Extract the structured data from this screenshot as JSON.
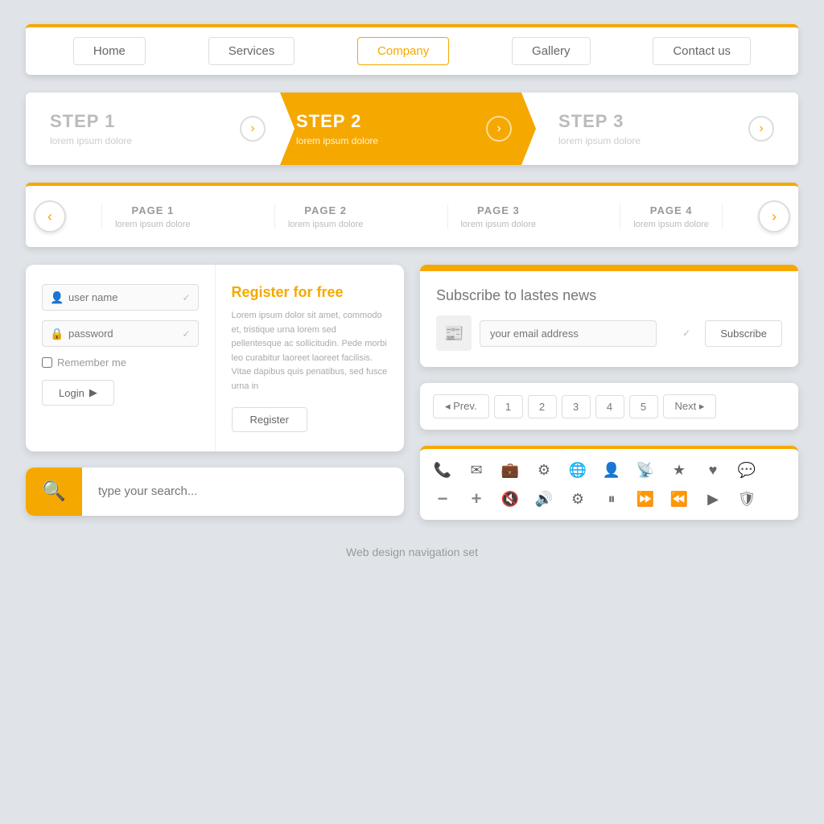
{
  "nav": {
    "items": [
      {
        "label": "Home",
        "active": false
      },
      {
        "label": "Services",
        "active": false
      },
      {
        "label": "Company",
        "active": true
      },
      {
        "label": "Gallery",
        "active": false
      },
      {
        "label": "Contact us",
        "active": false
      }
    ]
  },
  "steps": [
    {
      "title": "STEP 1",
      "subtitle": "lorem ipsum dolore",
      "active": false
    },
    {
      "title": "STEP 2",
      "subtitle": "lorem ipsum dolore",
      "active": true
    },
    {
      "title": "STEP 3",
      "subtitle": "lorem ipsum dolore",
      "active": false
    }
  ],
  "pages": [
    {
      "title": "PAGE 1",
      "subtitle": "lorem ipsum dolore"
    },
    {
      "title": "PAGE 2",
      "subtitle": "lorem ipsum dolore"
    },
    {
      "title": "PAGE 3",
      "subtitle": "lorem ipsum dolore"
    },
    {
      "title": "PAGE 4",
      "subtitle": "lorem ipsum dolore"
    }
  ],
  "login": {
    "username_placeholder": "user name",
    "password_placeholder": "password",
    "remember_label": "Remember me",
    "login_btn": "Login",
    "register_title": "Register for free",
    "register_text": "Lorem ipsum dolor sit amet, commodo et, tristique urna lorem sed pellentesque ac sollicitudin. Pede morbi leo curabitur laoreet laoreet facilisis. Vitae dapibus quis penatibus, sed fusce urna in",
    "register_btn": "Register"
  },
  "subscribe": {
    "title": "Subscribe to lastes news",
    "email_placeholder": "your email address",
    "subscribe_btn": "Subscribe"
  },
  "pagination": {
    "prev": "◂ Prev.",
    "pages": [
      "1",
      "2",
      "3",
      "4",
      "5"
    ],
    "next": "Next ▸"
  },
  "search": {
    "placeholder": "type your search..."
  },
  "footer": {
    "label": "Web design navigation set"
  },
  "icons": {
    "row1": [
      "📞",
      "✉",
      "🗃",
      "⚙",
      "🌐",
      "👤",
      "📡",
      "★",
      "♥",
      "💬"
    ],
    "row2": [
      "−",
      "+",
      "🔇",
      "🔊",
      "⚙",
      "⏸",
      "⏩",
      "⏪",
      "▶",
      "🛡"
    ]
  }
}
